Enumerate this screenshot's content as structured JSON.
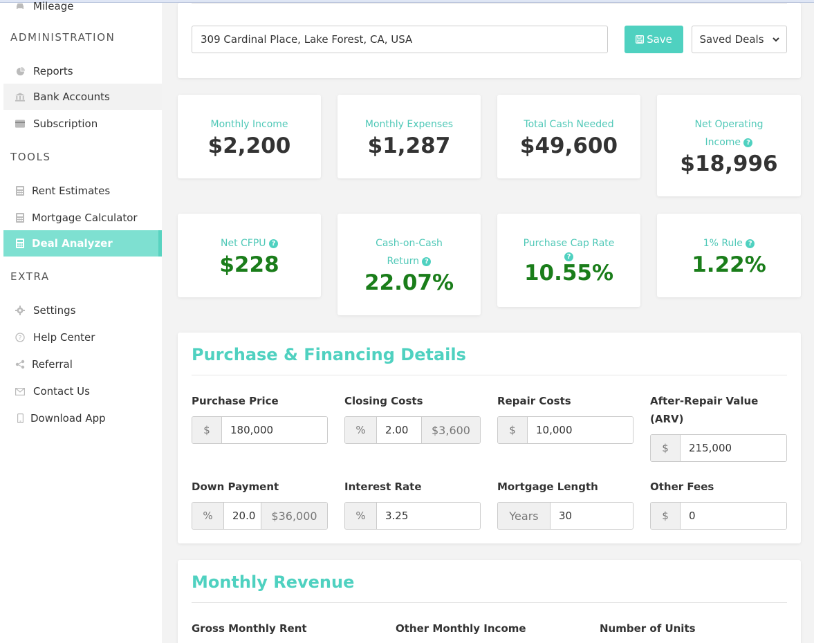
{
  "sidebar": {
    "partial_item": "Mileage",
    "admin_heading": "ADMINISTRATION",
    "admin_items": [
      {
        "label": "Reports",
        "icon": "pie-chart-icon"
      },
      {
        "label": "Bank Accounts",
        "icon": "bank-icon"
      },
      {
        "label": "Subscription",
        "icon": "card-icon"
      }
    ],
    "tools_heading": "TOOLS",
    "tools_items": [
      {
        "label": "Rent Estimates",
        "icon": "calculator-icon"
      },
      {
        "label": "Mortgage Calculator",
        "icon": "calculator-icon"
      },
      {
        "label": "Deal Analyzer",
        "icon": "calculator-icon"
      }
    ],
    "extra_heading": "EXTRA",
    "extra_items": [
      {
        "label": "Settings",
        "icon": "gear-icon"
      },
      {
        "label": "Help Center",
        "icon": "question-icon"
      },
      {
        "label": "Referral",
        "icon": "share-icon"
      },
      {
        "label": "Contact Us",
        "icon": "envelope-icon"
      },
      {
        "label": "Download App",
        "icon": "phone-icon"
      }
    ]
  },
  "address": {
    "value": "309 Cardinal Place, Lake Forest, CA, USA"
  },
  "toolbar": {
    "save_label": "Save",
    "saved_deals_label": "Saved Deals"
  },
  "stats": {
    "monthly_income": {
      "label": "Monthly Income",
      "value": "$2,200"
    },
    "monthly_expenses": {
      "label": "Monthly Expenses",
      "value": "$1,287"
    },
    "total_cash_needed": {
      "label": "Total Cash Needed",
      "value": "$49,600"
    },
    "noi": {
      "label_line1": "Net Operating",
      "label_line2": "Income",
      "value": "$18,996"
    },
    "net_cfpu": {
      "label": "Net CFPU",
      "value": "$228"
    },
    "coc": {
      "label_line1": "Cash-on-Cash",
      "label_line2": "Return",
      "value": "22.07%"
    },
    "cap_rate": {
      "label": "Purchase Cap Rate",
      "value": "10.55%"
    },
    "one_pct": {
      "label": "1% Rule",
      "value": "1.22%"
    }
  },
  "purchase": {
    "title": "Purchase & Financing Details",
    "purchase_price": {
      "label": "Purchase Price",
      "prefix": "$",
      "value": "180,000"
    },
    "closing_costs": {
      "label": "Closing Costs",
      "prefix": "%",
      "value": "2.00",
      "computed": "$3,600"
    },
    "repair_costs": {
      "label": "Repair Costs",
      "prefix": "$",
      "value": "10,000"
    },
    "arv": {
      "label_line1": "After-Repair Value",
      "label_line2": "(ARV)",
      "prefix": "$",
      "value": "215,000"
    },
    "down_payment": {
      "label": "Down Payment",
      "prefix": "%",
      "value": "20.0",
      "computed": "$36,000"
    },
    "interest_rate": {
      "label": "Interest Rate",
      "prefix": "%",
      "value": "3.25"
    },
    "mortgage_length": {
      "label": "Mortgage Length",
      "prefix": "Years",
      "value": "30"
    },
    "other_fees": {
      "label": "Other Fees",
      "prefix": "$",
      "value": "0"
    }
  },
  "revenue": {
    "title": "Monthly Revenue",
    "gross_rent_label": "Gross Monthly Rent",
    "other_income_label": "Other Monthly Income",
    "units_label": "Number of Units"
  },
  "colors": {
    "accent": "#4fd1c0",
    "active_nav": "#7ee0d1",
    "positive": "#1a7d1a"
  }
}
